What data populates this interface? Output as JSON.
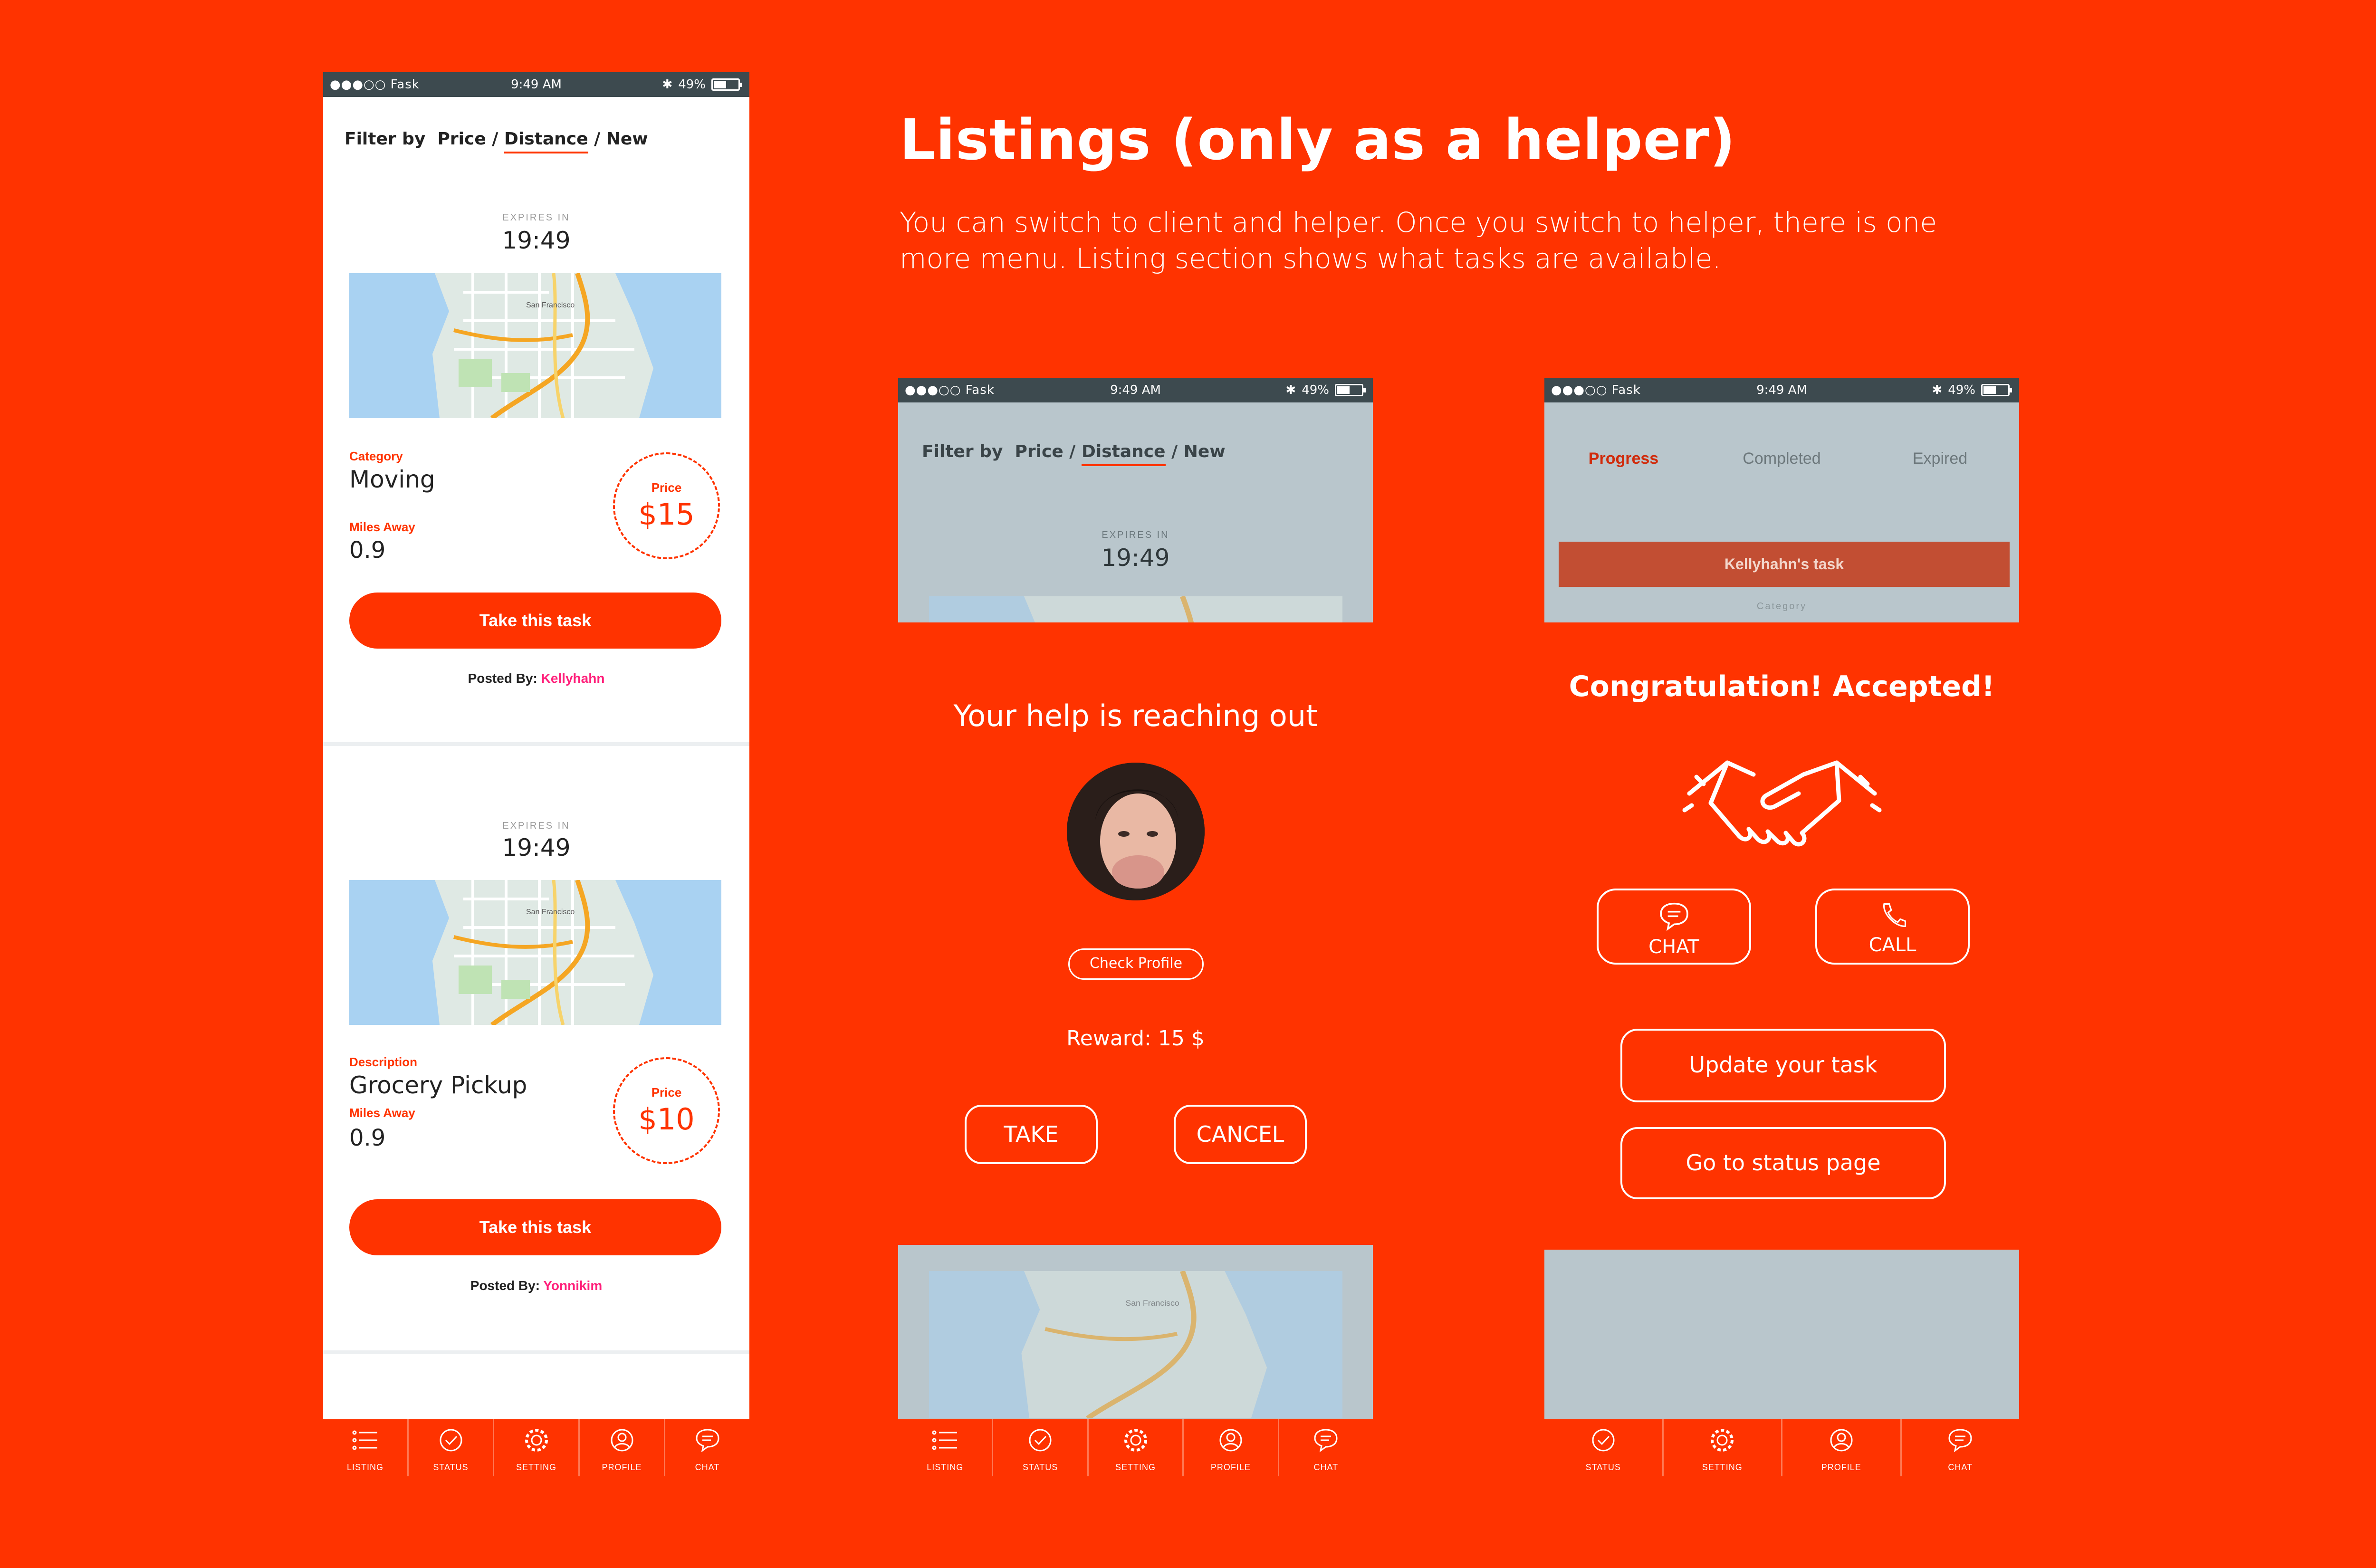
{
  "headline": "Listings (only as a helper)",
  "subtext": "You can switch to client and helper. Once you switch to helper, there is one more menu. Listing section shows what tasks are available.",
  "status": {
    "carrier": "●●●○○ Fask",
    "time": "9:49 AM",
    "battery": "49%"
  },
  "filter": {
    "prefix": "Filter by",
    "price": "Price",
    "sep1": "/",
    "distance": "Distance",
    "sep2": "/",
    "new": "New"
  },
  "listings": [
    {
      "expires_label": "EXPIRES IN",
      "expires": "19:49",
      "category_label": "Category",
      "category": "Moving",
      "miles_label": "Miles Away",
      "miles": "0.9",
      "price_label": "Price",
      "price": "$15",
      "button": "Take this task",
      "posted_label": "Posted By:",
      "posted_by": "Kellyhahn"
    },
    {
      "expires_label": "EXPIRES IN",
      "expires": "19:49",
      "category_label": "Description",
      "category": "Grocery Pickup",
      "miles_label": "Miles Away",
      "miles": "0.9",
      "price_label": "Price",
      "price": "$10",
      "button": "Take this task",
      "posted_label": "Posted By:",
      "posted_by": "Yonnikim"
    }
  ],
  "map_label": "San Francisco",
  "tabs_listing": [
    "LISTING",
    "STATUS",
    "SETTING",
    "PROFILE",
    "CHAT"
  ],
  "tabs_status": [
    "STATUS",
    "SETTING",
    "PROFILE",
    "CHAT"
  ],
  "popup": {
    "title": "Your help is reaching out",
    "check_profile": "Check Profile",
    "reward": "Reward: 15 $",
    "take": "TAKE",
    "cancel": "CANCEL"
  },
  "accepted": {
    "progress_tabs": [
      "Progress",
      "Completed",
      "Expired"
    ],
    "task_title": "Kellyhahn's task",
    "category_label": "Category",
    "title": "Congratulation! Accepted!",
    "chat": "CHAT",
    "call": "CALL",
    "update": "Update your task",
    "status": "Go to status page"
  },
  "colors": {
    "brand": "#FF3300",
    "accent_pink": "#FF1F7A",
    "statusbar": "#3d4a4f"
  }
}
